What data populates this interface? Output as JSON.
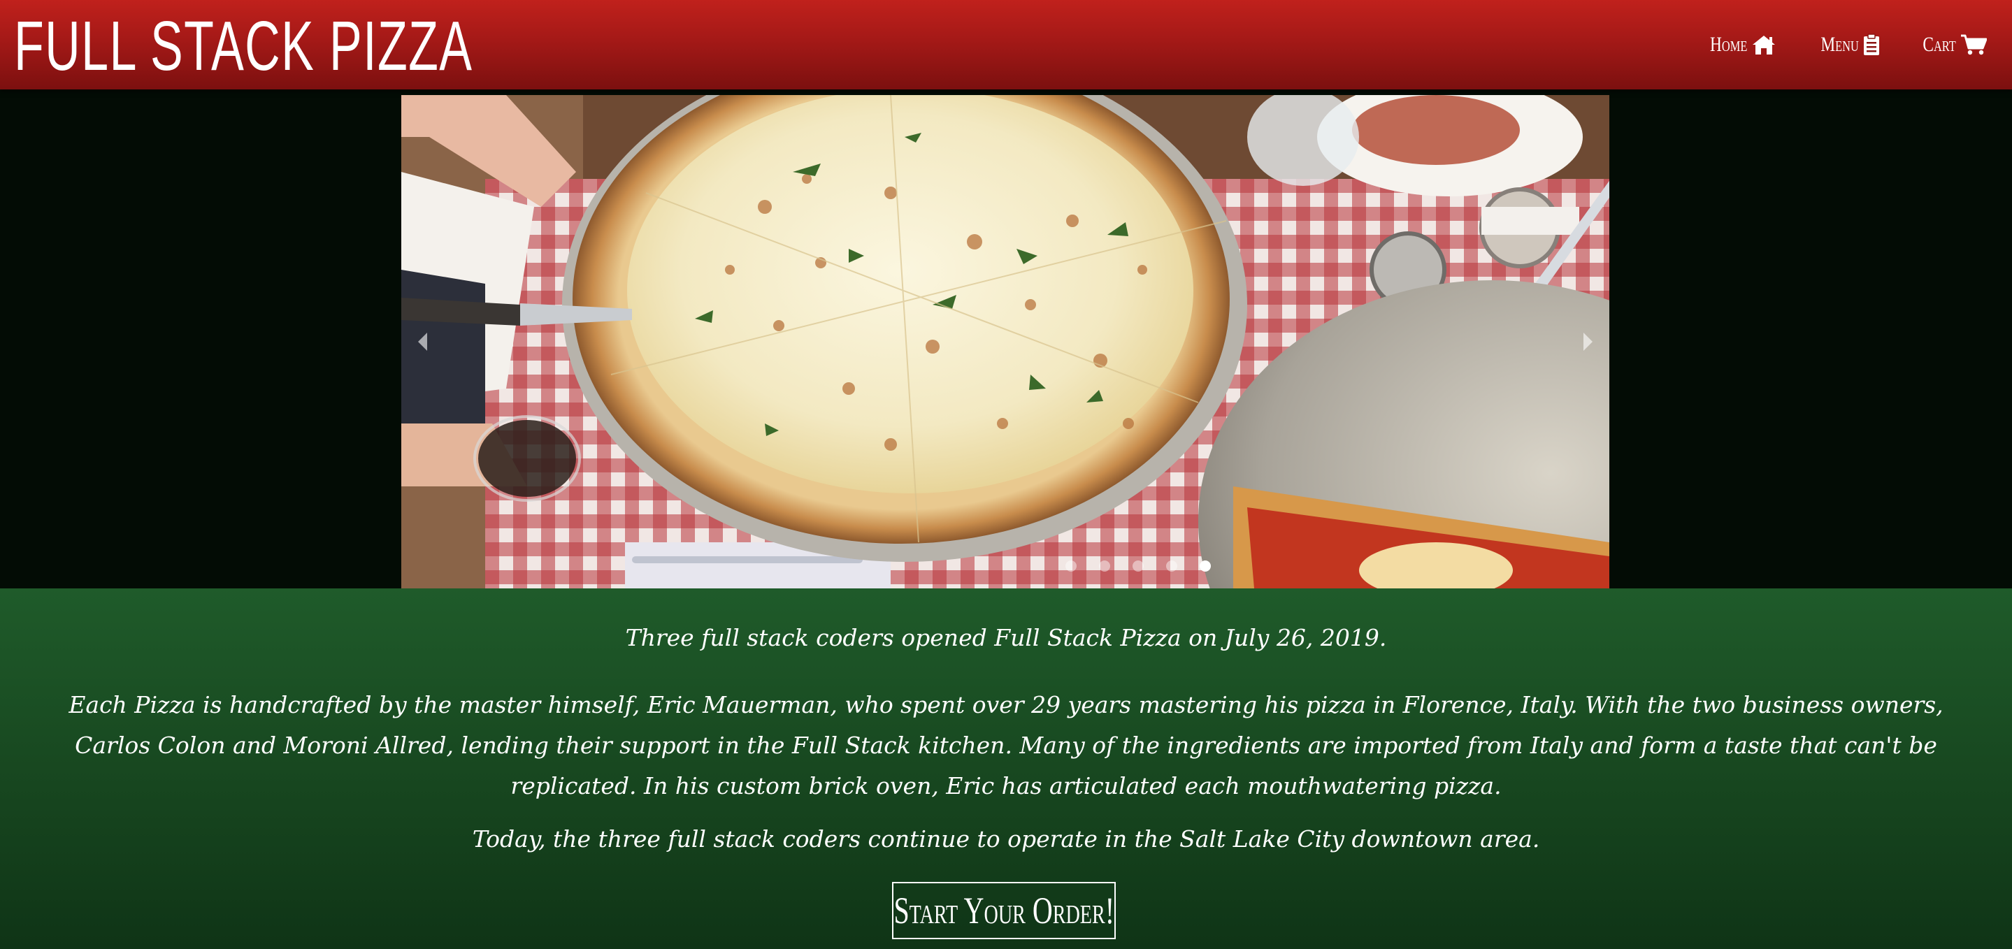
{
  "navbar": {
    "brand": "FULL STACK PIZZA",
    "links": [
      {
        "label": "Home",
        "icon": "home-icon"
      },
      {
        "label": "Menu",
        "icon": "clipboard-icon"
      },
      {
        "label": "Cart",
        "icon": "shopping-cart-icon"
      }
    ]
  },
  "carousel": {
    "slide_count": 5,
    "active_index": 4,
    "prev_icon": "chevron-left-icon",
    "next_icon": "chevron-right-icon"
  },
  "about": {
    "paragraph_1": "Three full stack coders opened Full Stack Pizza on July 26, 2019.",
    "paragraph_2": "Each Pizza is handcrafted by the master himself, Eric Mauerman, who spent over 29 years mastering his pizza in Florence, Italy. With the two business owners, Carlos Colon and Moroni Allred, lending their support in the Full Stack kitchen. Many of the ingredients are imported from Italy and form a taste that can't be replicated. In his custom brick oven, Eric has articulated each mouthwatering pizza.",
    "paragraph_3": "Today, the three full stack coders continue to operate in the Salt Lake City downtown area.",
    "order_button": "Start Your Order!"
  },
  "colors": {
    "navbar_red": "#a41917",
    "carousel_band": "#030c05",
    "section_green": "#1f5b2a",
    "text": "#ffffff"
  }
}
